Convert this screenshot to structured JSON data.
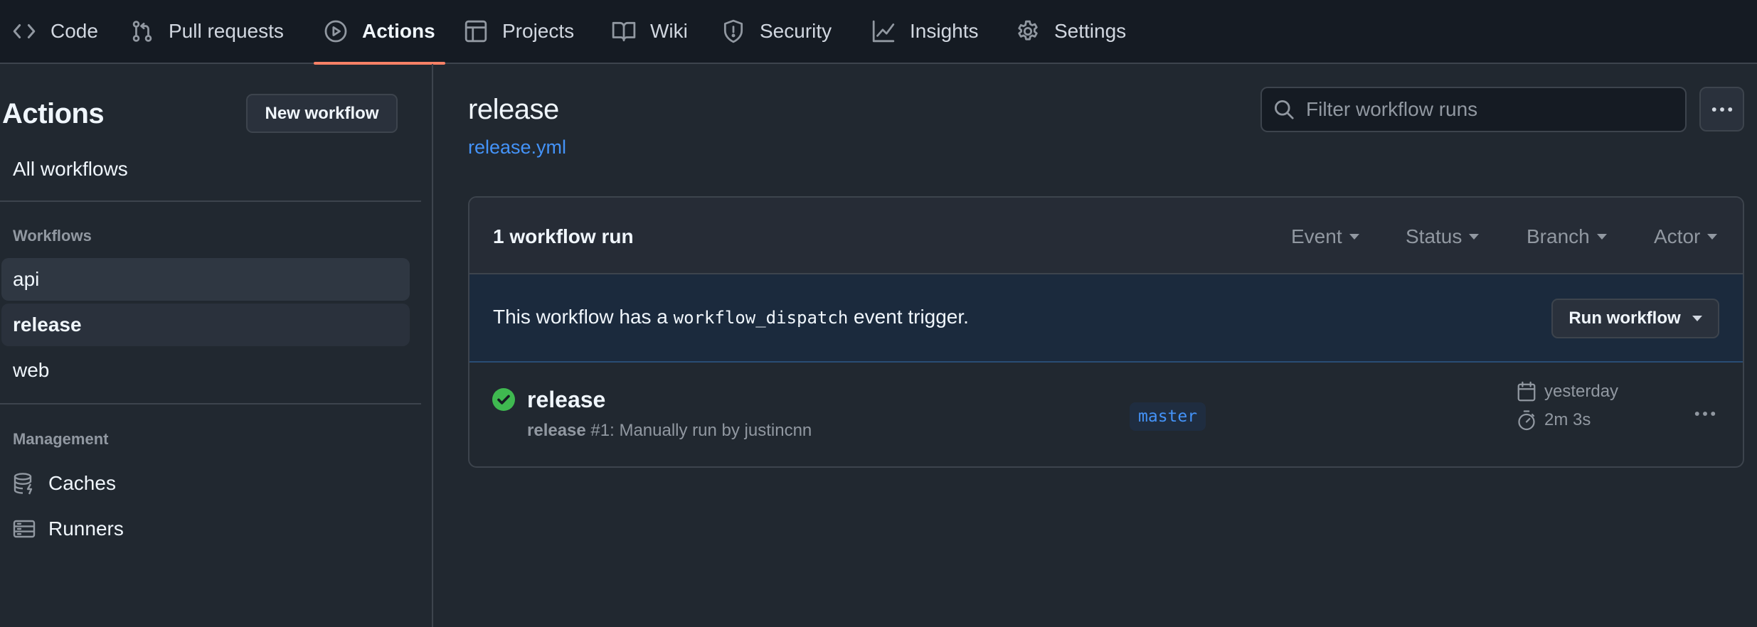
{
  "nav": {
    "tabs": [
      {
        "label": "Code",
        "icon": "code-icon"
      },
      {
        "label": "Pull requests",
        "icon": "pull-request-icon"
      },
      {
        "label": "Actions",
        "icon": "play-icon",
        "active": true
      },
      {
        "label": "Projects",
        "icon": "table-icon"
      },
      {
        "label": "Wiki",
        "icon": "book-icon"
      },
      {
        "label": "Security",
        "icon": "shield-icon"
      },
      {
        "label": "Insights",
        "icon": "graph-icon"
      },
      {
        "label": "Settings",
        "icon": "gear-icon"
      }
    ]
  },
  "sidebar": {
    "title": "Actions",
    "new_workflow_label": "New workflow",
    "all_workflows_label": "All workflows",
    "workflows_heading": "Workflows",
    "workflows": [
      {
        "label": "api"
      },
      {
        "label": "release",
        "selected": true
      },
      {
        "label": "web"
      }
    ],
    "management_heading": "Management",
    "management": [
      {
        "label": "Caches",
        "icon": "database-icon"
      },
      {
        "label": "Runners",
        "icon": "server-icon"
      }
    ]
  },
  "main": {
    "title": "release",
    "file": "release.yml",
    "filter_placeholder": "Filter workflow runs",
    "runs_count": "1 workflow run",
    "filters": [
      {
        "label": "Event"
      },
      {
        "label": "Status"
      },
      {
        "label": "Branch"
      },
      {
        "label": "Actor"
      }
    ],
    "dispatch": {
      "text_before": "This workflow has a ",
      "code": "workflow_dispatch",
      "text_after": " event trigger.",
      "button_label": "Run workflow"
    },
    "runs": [
      {
        "name": "release",
        "meta_bold": "release",
        "meta_rest": " #1: Manually run by justincnn",
        "branch": "master",
        "when": "yesterday",
        "duration": "2m 3s",
        "status": "success"
      }
    ]
  },
  "colors": {
    "accent_underline": "#f78166",
    "link": "#4493f8",
    "success": "#3fb950",
    "background": "#212830",
    "header_background": "#151b23"
  }
}
